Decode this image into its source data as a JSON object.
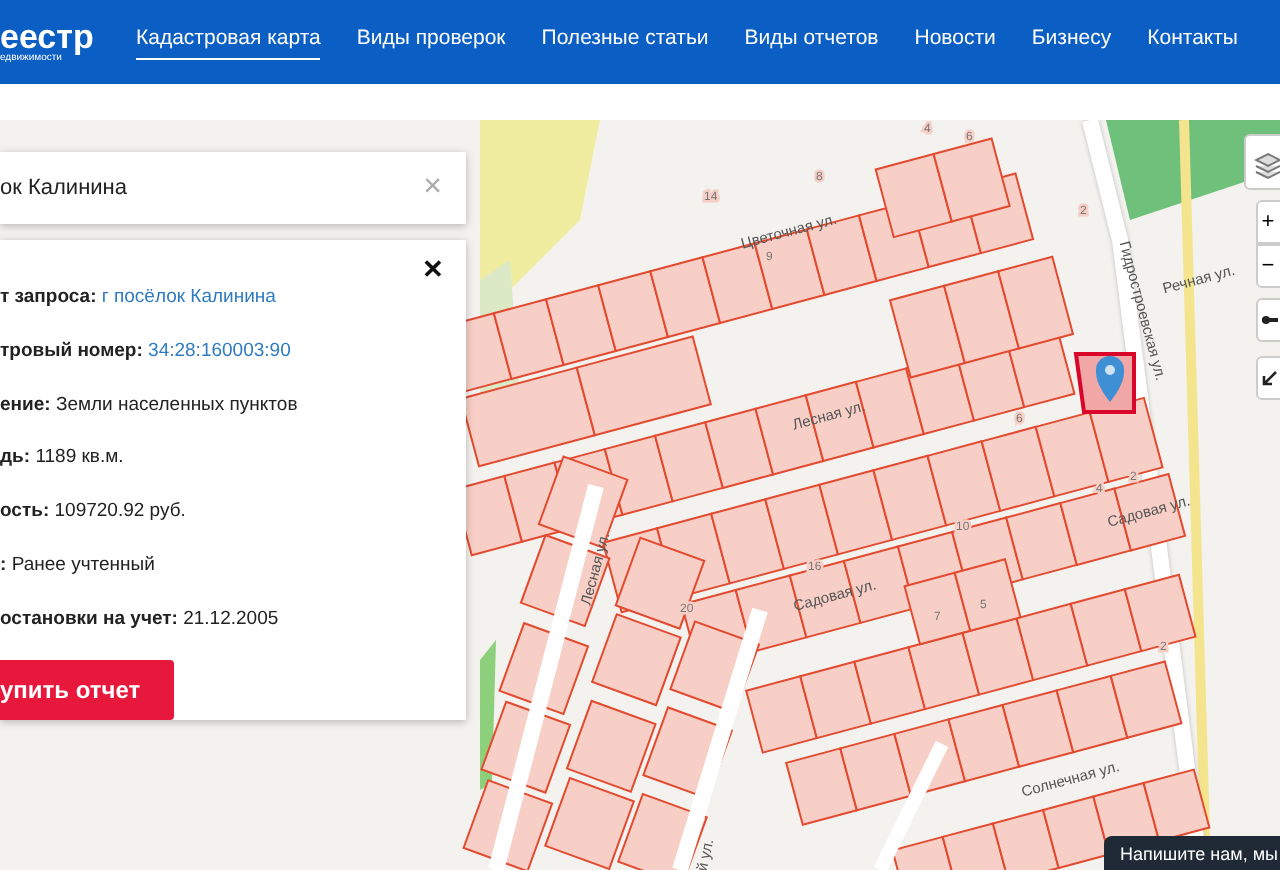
{
  "header": {
    "logo": "еестр",
    "logo_subtitle": "едвижимости",
    "nav": [
      {
        "label": "Кадастровая карта",
        "selected": true
      },
      {
        "label": "Виды проверок",
        "selected": false
      },
      {
        "label": "Полезные статьи",
        "selected": false
      },
      {
        "label": "Виды отчетов",
        "selected": false
      },
      {
        "label": "Новости",
        "selected": false
      },
      {
        "label": "Бизнесу",
        "selected": false
      },
      {
        "label": "Контакты",
        "selected": false
      }
    ]
  },
  "search": {
    "value": "ок Калинина",
    "clear": "×"
  },
  "info_card": {
    "close": "✕",
    "rows": [
      {
        "label": "т запроса:",
        "value": "г посёлок Калинина",
        "kind": "link"
      },
      {
        "label": "тровый номер:",
        "value": "34:28:160003:90",
        "kind": "link"
      },
      {
        "label": "ение:",
        "value": "Земли населенных пунктов",
        "kind": "text"
      },
      {
        "label": "дь:",
        "value": "1189 кв.м.",
        "kind": "text"
      },
      {
        "label": "ость:",
        "value": "109720.92 руб.",
        "kind": "text"
      },
      {
        "label": ":",
        "value": "Ранее учтенный",
        "kind": "text"
      },
      {
        "label": "остановки на учет:",
        "value": "21.12.2005",
        "kind": "text"
      }
    ],
    "button": "упить отчет"
  },
  "map": {
    "street_labels": [
      "Цветочная ул.",
      "Лесная ул.",
      "Речная ул.",
      "Гидростроевская ул.",
      "Садовая ул.",
      "Садовая ул.",
      "Лесная ул.",
      "Солнечная ул.",
      "й ул."
    ],
    "house_numbers": [
      "6",
      "4",
      "8",
      "14",
      "9",
      "2",
      "6",
      "2",
      "20",
      "4",
      "10",
      "16",
      "7",
      "5",
      "2"
    ],
    "zoom_in": "+",
    "zoom_out": "−"
  },
  "chat": {
    "text": "Напишите нам, мы"
  }
}
